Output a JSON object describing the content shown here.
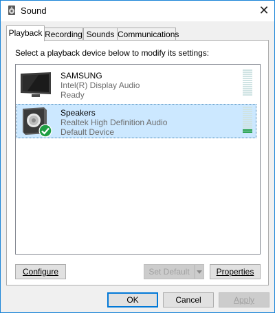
{
  "window": {
    "title": "Sound",
    "close_symbol": "✕"
  },
  "tabs": [
    {
      "label": "Playback",
      "active": true
    },
    {
      "label": "Recording",
      "active": false
    },
    {
      "label": "Sounds",
      "active": false
    },
    {
      "label": "Communications",
      "active": false
    }
  ],
  "playback": {
    "instruction": "Select a playback device below to modify its settings:",
    "devices": [
      {
        "name": "SAMSUNG",
        "driver": "Intel(R) Display Audio",
        "status": "Ready",
        "icon": "monitor-icon",
        "selected": false,
        "default": false
      },
      {
        "name": "Speakers",
        "driver": "Realtek High Definition Audio",
        "status": "Default Device",
        "icon": "speaker-icon",
        "selected": true,
        "default": true
      }
    ],
    "configure_label": "Configure",
    "set_default_label": "Set Default",
    "properties_label": "Properties"
  },
  "footer": {
    "ok_label": "OK",
    "cancel_label": "Cancel",
    "apply_label": "Apply"
  },
  "colors": {
    "accent": "#0078d7",
    "selected_bg": "#cce8ff",
    "level_on": "#1e9e43",
    "default_check": "#1e9e43"
  }
}
